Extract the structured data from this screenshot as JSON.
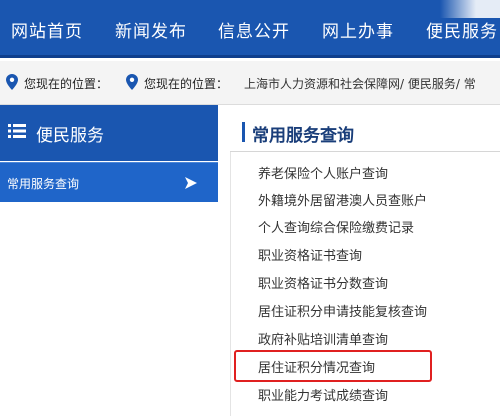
{
  "nav": {
    "items": [
      "网站首页",
      "新闻发布",
      "信息公开",
      "网上办事",
      "便民服务"
    ]
  },
  "breadcrumb": {
    "location_label_1": "您现在的位置：",
    "location_label_2": "您现在的位置：",
    "path": [
      "上海市人力资源和社会保障网",
      "便民服务",
      "常"
    ],
    "separator": "/"
  },
  "sidebar": {
    "title": "便民服务",
    "items": [
      {
        "label": "常用服务查询",
        "icon": "play-arrow-icon"
      }
    ]
  },
  "main": {
    "title": "常用服务查询",
    "services": [
      "养老保险个人账户查询",
      "外籍境外居留港澳人员查账户",
      "个人查询综合保险缴费记录",
      "职业资格证书查询",
      "职业资格证书分数查询",
      "居住证积分申请技能复核查询",
      "政府补贴培训清单查询",
      "居住证积分情况查询",
      "职业能力考试成绩查询"
    ],
    "highlighted_service": "居住证积分情况查询"
  },
  "colors": {
    "nav_bg": "#1a56b0",
    "sidebar_active": "#1f65c9",
    "pin": "#1a56b0",
    "highlight": "#e02020"
  }
}
